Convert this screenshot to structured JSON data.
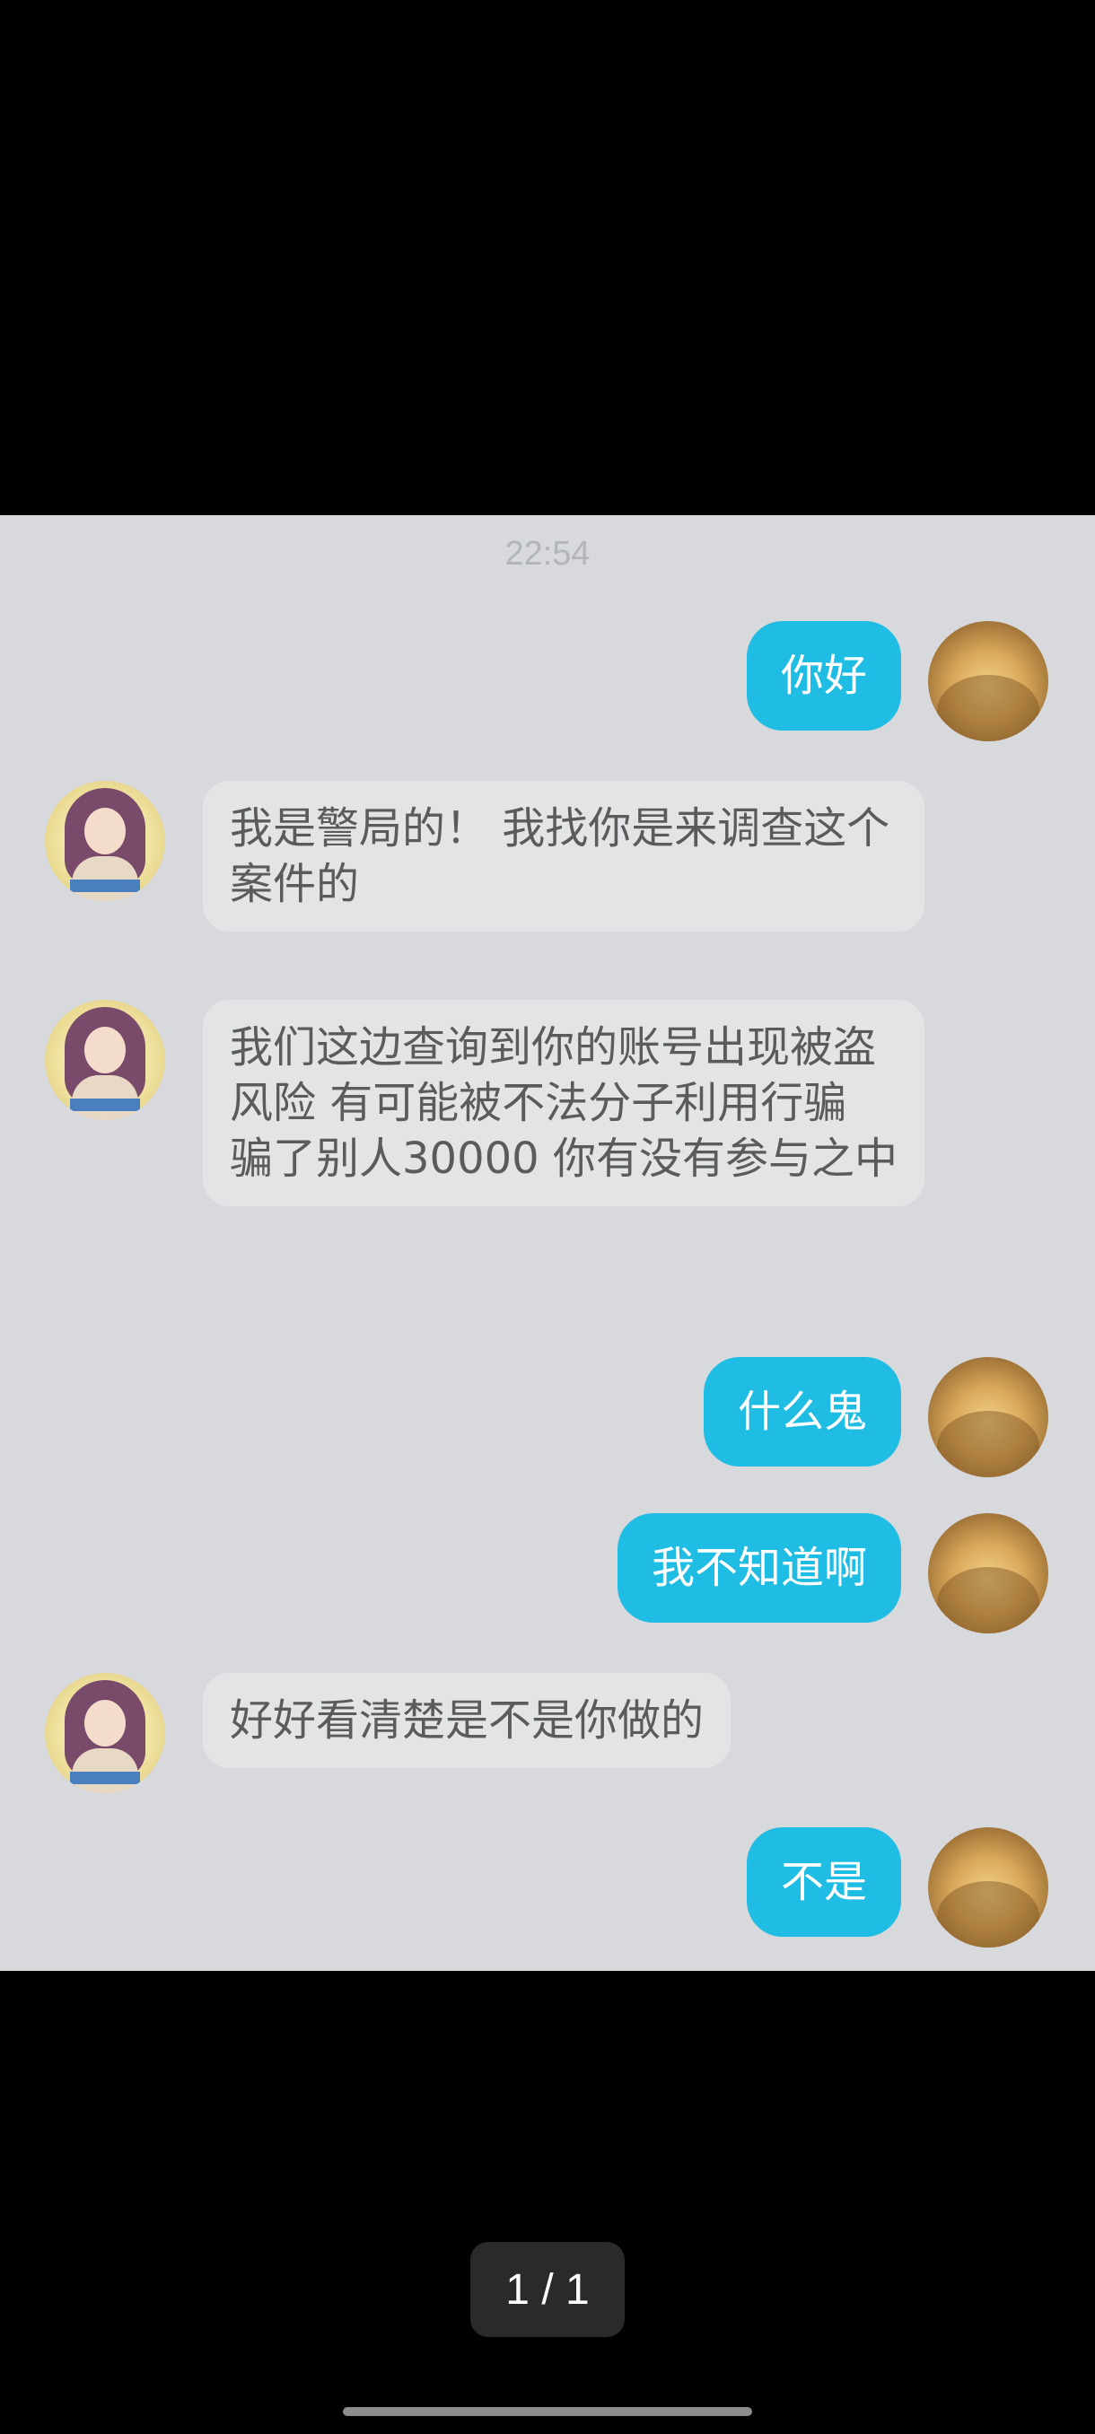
{
  "conversation": {
    "timestamp": "22:54",
    "messages": [
      {
        "sender": "self",
        "text": "你好"
      },
      {
        "sender": "other",
        "text": "我是警局的！ 我找你是来调查这个案件的"
      },
      {
        "sender": "other",
        "text": "我们这边查询到你的账号出现被盗风险 有可能被不法分子利用行骗 骗了别人30000 你有没有参与之中"
      },
      {
        "sender": "self",
        "text": "什么鬼"
      },
      {
        "sender": "self",
        "text": "我不知道啊"
      },
      {
        "sender": "other",
        "text": "好好看清楚是不是你做的"
      },
      {
        "sender": "self",
        "text": "不是"
      }
    ]
  },
  "viewer": {
    "page_counter": "1 / 1"
  },
  "colors": {
    "outgoing_bubble": "#1fbde3",
    "incoming_bubble": "#e3e4e6",
    "chat_background": "#d7d9dc",
    "viewer_background": "#000000"
  }
}
